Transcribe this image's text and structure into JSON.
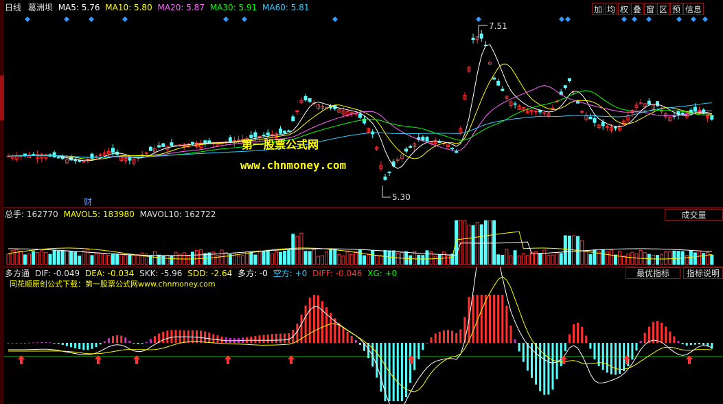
{
  "header": {
    "period": "日线",
    "stock": "葛洲坝",
    "ma": [
      {
        "label": "MA5: 5.76",
        "color": "#ffffff"
      },
      {
        "label": "MA10: 5.80",
        "color": "#ffff00"
      },
      {
        "label": "MA20: 5.87",
        "color": "#ff66ff"
      },
      {
        "label": "MA30: 5.91",
        "color": "#00ff00"
      },
      {
        "label": "MA60: 5.81",
        "color": "#33ccff"
      }
    ]
  },
  "toolbar": [
    "加",
    "均",
    "权",
    "叠",
    "窗",
    "区",
    "预",
    "信息"
  ],
  "main": {
    "high_label": "7.51",
    "low_label": "5.30",
    "fin_marker": "财",
    "watermark_title": "第一股票公式网",
    "watermark_url": "www.chnmoney.com"
  },
  "volume": {
    "title": "总手: 162770",
    "mavol5": "MAVOL5: 183980",
    "mavol10": "MAVOL10: 162722",
    "button": "成交量"
  },
  "indicator": {
    "name": "多方通",
    "dif": "DIF: -0.049",
    "dea": "DEA: -0.034",
    "skk": "SKK: -5.96",
    "sdd": "SDD: -2.64",
    "duofang": "多方: -0",
    "kongfang": "空方: +0",
    "diff": "DIFF: -0.046",
    "xg": "XG: +0",
    "subtitle": "同花顺原创公式下载：第一股票公式网www.chnmoney.com",
    "btn_best": "最优指标",
    "btn_help": "指标说明"
  },
  "colors": {
    "up": "#ff3232",
    "down": "#54ffff",
    "border": "#8a1a1a",
    "signal_arrow": "#ff3232",
    "diamond": "#3399ff"
  }
}
